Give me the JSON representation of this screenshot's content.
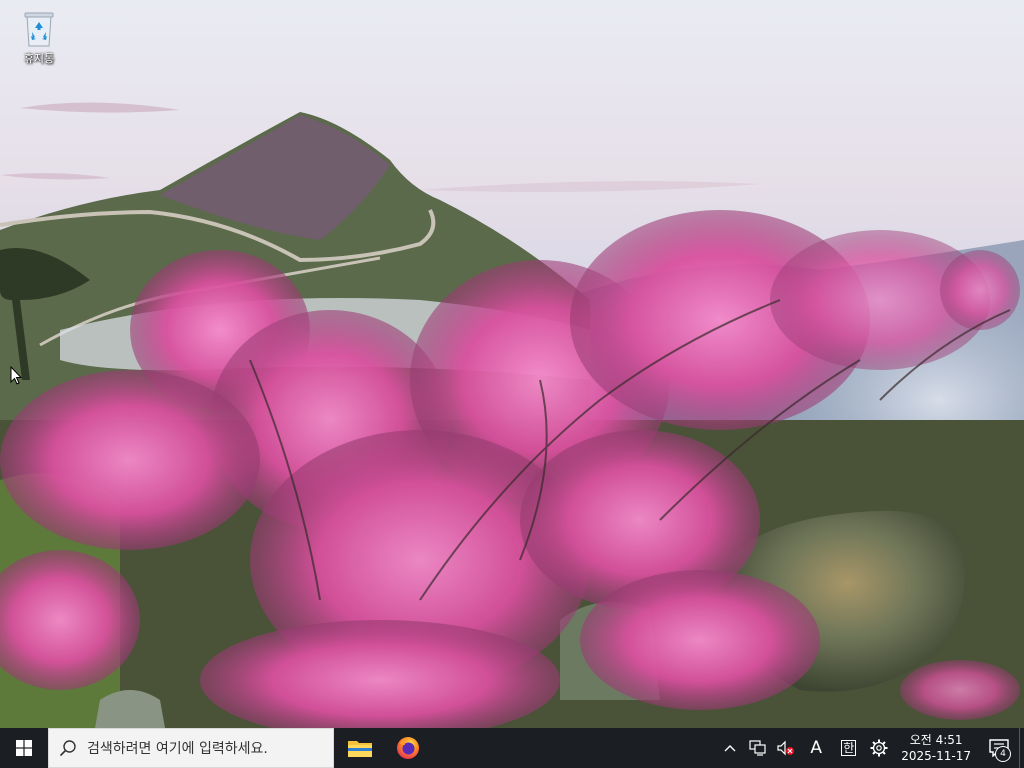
{
  "desktop": {
    "icons": [
      {
        "label": "휴지통",
        "icon": "recycle-bin-icon"
      }
    ]
  },
  "taskbar": {
    "search": {
      "placeholder": "검색하려면 여기에 입력하세요."
    },
    "apps": [
      {
        "name": "file-explorer",
        "icon": "folder-icon"
      },
      {
        "name": "firefox",
        "icon": "firefox-icon"
      }
    ],
    "tray": {
      "ime_mode": "A",
      "ime_han": "한",
      "clock": {
        "time": "오전 4:51",
        "date": "2025-11-17"
      },
      "notification_count": "4"
    }
  },
  "colors": {
    "taskbar_bg": "#1b1e23",
    "search_bg": "#f3f3f3",
    "flower_pink": "#e45aa8"
  }
}
